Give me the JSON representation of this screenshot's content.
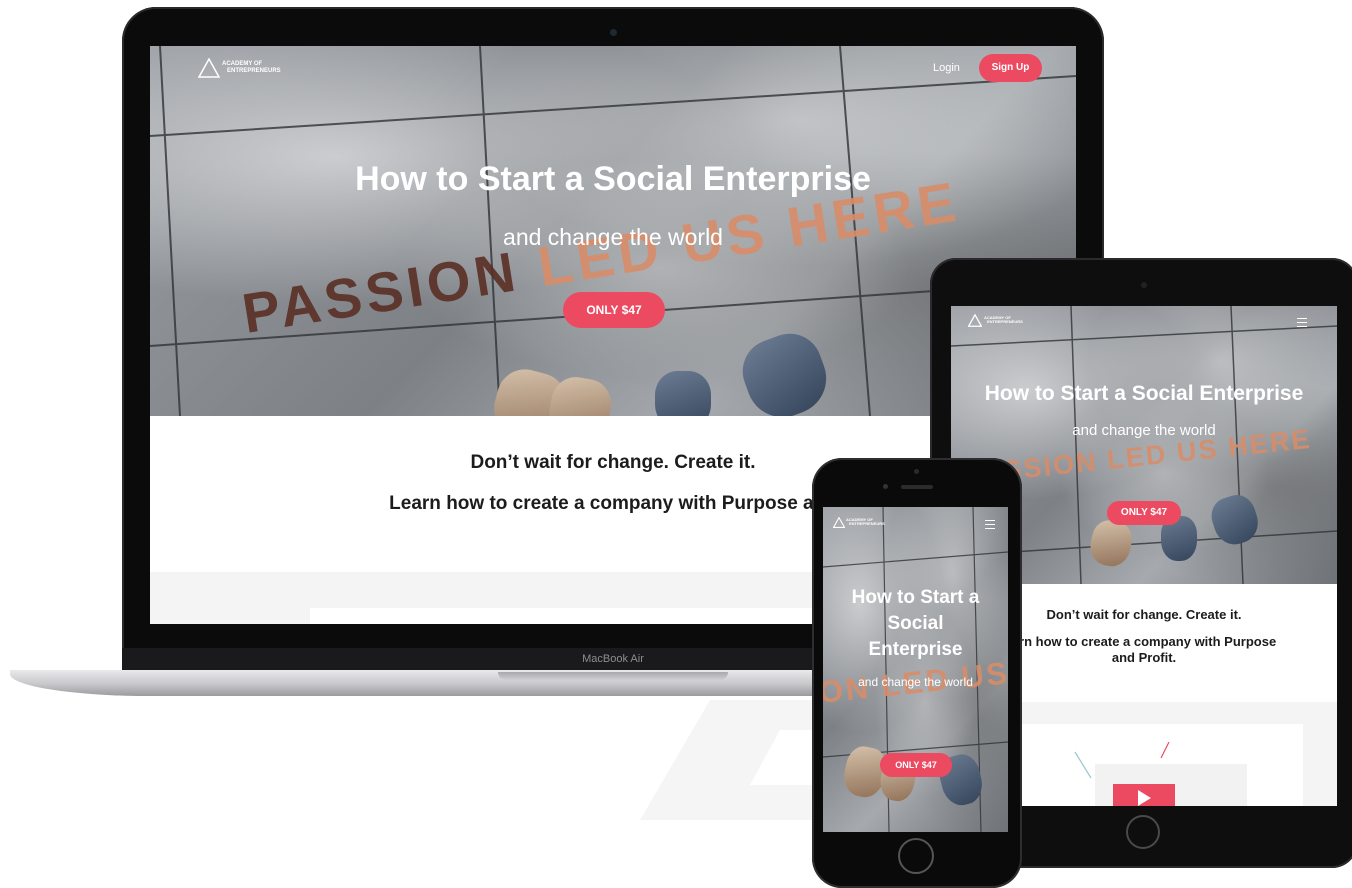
{
  "brand": {
    "logo_line1": "ACADEMY OF",
    "logo_line2": "ENTREPRENEURS",
    "accent": "#ec4a61"
  },
  "nav": {
    "login": "Login",
    "signup": "Sign Up"
  },
  "hero": {
    "title": "How to Start a Social Enterprise",
    "subtitle": "and change the world",
    "cta": "ONLY $47",
    "floor_text_laptop_a": "PASSION ",
    "floor_text_laptop_b": "LED US HERE",
    "floor_text_tablet": "SSION LED US HERE",
    "floor_text_phone": "ON LED US"
  },
  "phone_hero": {
    "title_line1": "How to Start a",
    "title_line2": "Social",
    "title_line3": "Enterprise"
  },
  "content": {
    "tagline": "Don’t wait for change. Create it.",
    "laptop_line": "Learn how to create a company with Purpose and",
    "tablet_line1": "arn how to create a company with Purpose",
    "tablet_line2": "and Profit."
  },
  "devices": {
    "laptop_label": "MacBook Air"
  }
}
